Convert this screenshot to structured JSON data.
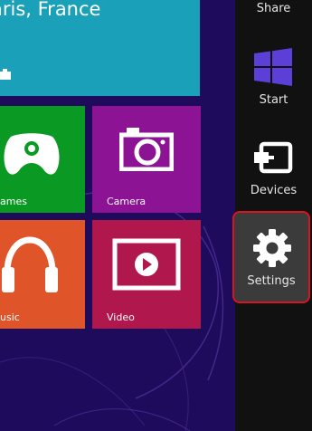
{
  "start_screen": {
    "tiles": {
      "weather": {
        "location": "aris, France"
      },
      "games": {
        "label": "ames"
      },
      "camera": {
        "label": "Camera"
      },
      "music": {
        "label": "usic"
      },
      "video": {
        "label": "Video"
      }
    }
  },
  "charms": {
    "share": {
      "label": "Share"
    },
    "start": {
      "label": "Start"
    },
    "devices": {
      "label": "Devices"
    },
    "settings": {
      "label": "Settings",
      "selected": true
    }
  },
  "colors": {
    "weather_tile": "#1aa0b8",
    "games_tile": "#0a9a24",
    "camera_tile": "#8c1494",
    "music_tile": "#e0542a",
    "video_tile": "#b0174c",
    "start_logo": "#5b3fd6",
    "charms_bar": "#111111",
    "highlight_border": "#d9141b"
  }
}
